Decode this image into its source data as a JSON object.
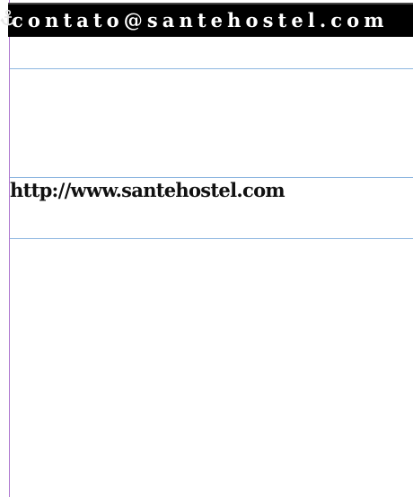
{
  "document": {
    "email_text": "contato@santehostel.com",
    "url_text": "http://www.santehostel.com",
    "colors": {
      "email_bar_background": "#000000",
      "email_text": "#ffffff",
      "url_text": "#111111",
      "margin_guide": "#b07ad0",
      "horizontal_guides": "#8db6e0"
    },
    "icons": [
      "anchor-icon"
    ]
  }
}
